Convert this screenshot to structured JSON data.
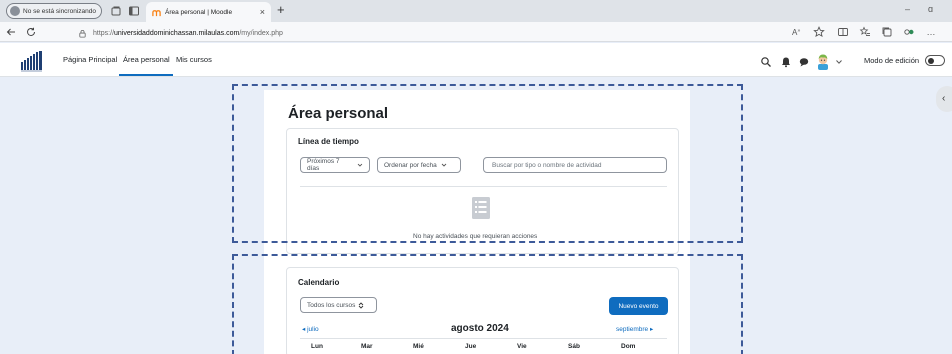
{
  "browser": {
    "profile_label": "No se está sincronizando",
    "tab_title": "Área personal | Moodle",
    "tab_close": "×",
    "new_tab": "+",
    "url_prefix": "https://",
    "url_host": "universidaddominichassan.milaulas.com",
    "url_path": "/my/index.php",
    "minimize": "–",
    "restore": "ɑ",
    "more": "…"
  },
  "navbar": {
    "links": [
      "Página Principal",
      "Área personal",
      "Mis cursos"
    ],
    "edit_mode_label": "Modo de edición"
  },
  "page": {
    "title": "Área personal",
    "drawer_toggle": "‹"
  },
  "timeline": {
    "title": "Línea de tiempo",
    "filter_days": "Próximos 7 días",
    "sort": "Ordenar por fecha",
    "search_placeholder": "Buscar por tipo o nombre de actividad",
    "empty_message": "No hay actividades que requieran acciones"
  },
  "calendar": {
    "title": "Calendario",
    "course_filter": "Todos los cursos",
    "new_event": "Nuevo evento",
    "prev_month": "◂  julio",
    "current_month": "agosto 2024",
    "next_month": "septiembre  ▸",
    "day_headers": [
      "Lun",
      "Mar",
      "Mié",
      "Jue",
      "Vie",
      "Sáb",
      "Dom"
    ]
  },
  "colors": {
    "accent": "#0f6cbf",
    "page_bg": "#e8eef8",
    "dash_annotation": "#3d5a99"
  }
}
